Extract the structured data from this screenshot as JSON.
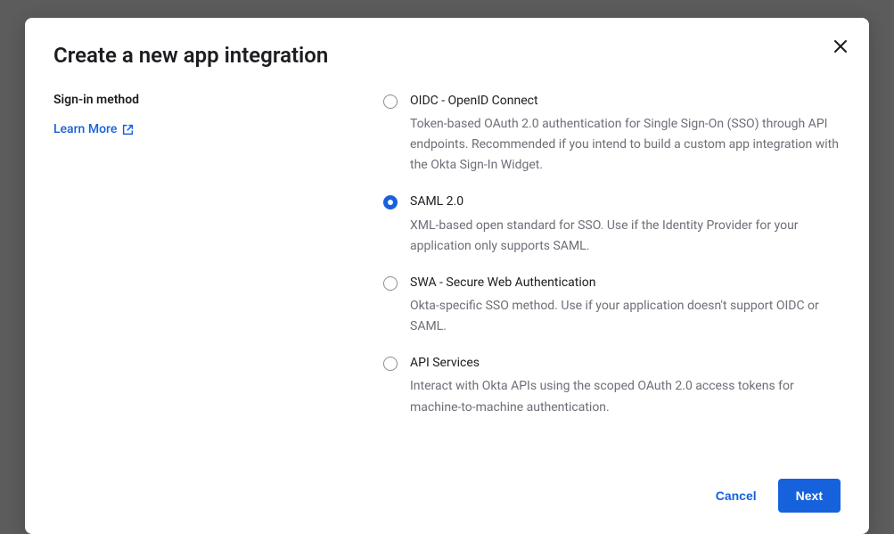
{
  "modal": {
    "title": "Create a new app integration",
    "section_label": "Sign-in method",
    "learn_more": "Learn More"
  },
  "options": [
    {
      "title": "OIDC - OpenID Connect",
      "desc": "Token-based OAuth 2.0 authentication for Single Sign-On (SSO) through API endpoints. Recommended if you intend to build a custom app integration with the Okta Sign-In Widget.",
      "selected": false
    },
    {
      "title": "SAML 2.0",
      "desc": "XML-based open standard for SSO. Use if the Identity Provider for your application only supports SAML.",
      "selected": true
    },
    {
      "title": "SWA - Secure Web Authentication",
      "desc": "Okta-specific SSO method. Use if your application doesn't support OIDC or SAML.",
      "selected": false
    },
    {
      "title": "API Services",
      "desc": "Interact with Okta APIs using the scoped OAuth 2.0 access tokens for machine-to-machine authentication.",
      "selected": false
    }
  ],
  "footer": {
    "cancel": "Cancel",
    "next": "Next"
  }
}
